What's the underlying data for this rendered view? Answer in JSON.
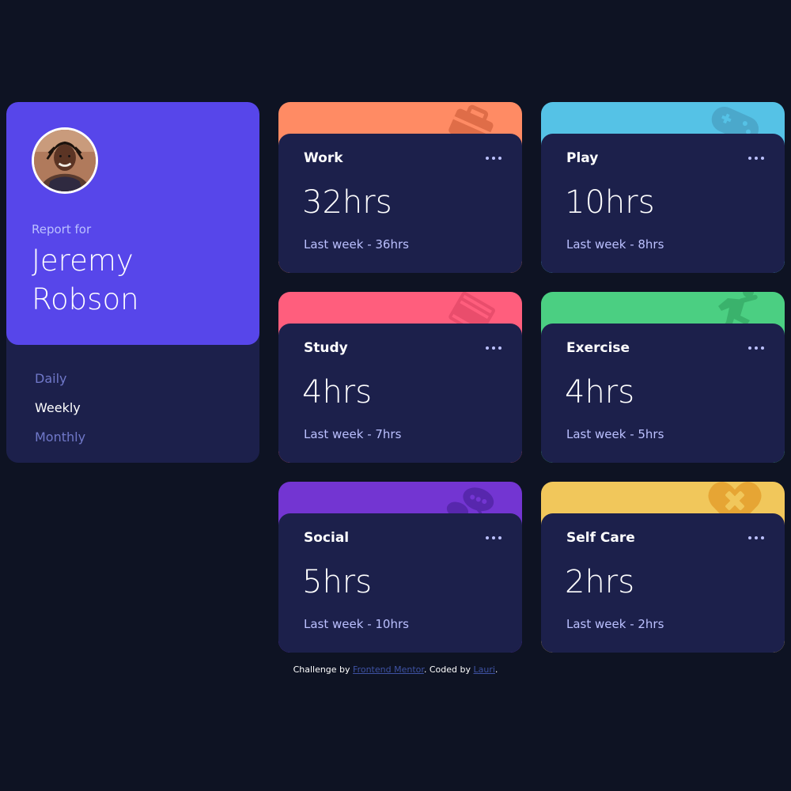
{
  "profile": {
    "report_for": "Report for",
    "first_name": "Jeremy",
    "last_name": "Robson",
    "periods": [
      {
        "label": "Daily"
      },
      {
        "label": "Weekly"
      },
      {
        "label": "Monthly"
      }
    ],
    "active_period": "Weekly"
  },
  "cards": [
    {
      "title": "Work",
      "hours": "32hrs",
      "previous": "Last week - 36hrs",
      "color": "#ff8b64",
      "icon": "briefcase-icon"
    },
    {
      "title": "Play",
      "hours": "10hrs",
      "previous": "Last week - 8hrs",
      "color": "#55c2e6",
      "icon": "gamepad-icon"
    },
    {
      "title": "Study",
      "hours": "4hrs",
      "previous": "Last week - 7hrs",
      "color": "#ff5e7d",
      "icon": "book-icon"
    },
    {
      "title": "Exercise",
      "hours": "4hrs",
      "previous": "Last week - 5hrs",
      "color": "#4bcf82",
      "icon": "running-icon"
    },
    {
      "title": "Social",
      "hours": "5hrs",
      "previous": "Last week - 10hrs",
      "color": "#7335d2",
      "icon": "chat-bubbles-icon"
    },
    {
      "title": "Self Care",
      "hours": "2hrs",
      "previous": "Last week - 2hrs",
      "color": "#f1c75b",
      "icon": "heart-bandage-icon"
    }
  ],
  "footer": {
    "prefix": "Challenge by ",
    "link1": "Frontend Mentor",
    "middle": ". Coded by ",
    "link2": "Lauri",
    "suffix": "."
  }
}
